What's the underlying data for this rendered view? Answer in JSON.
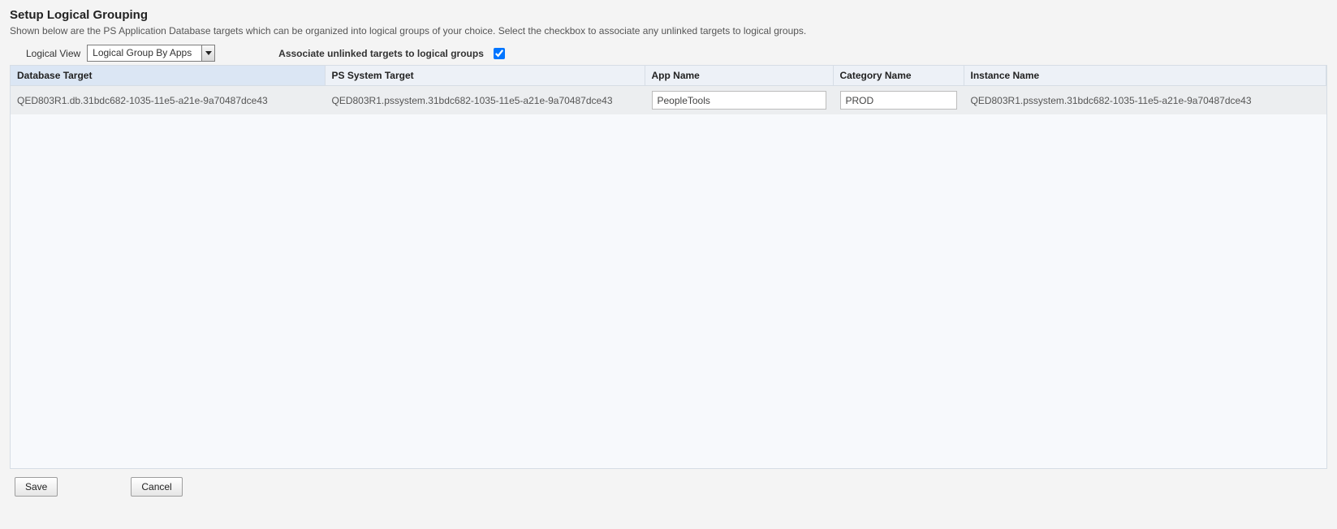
{
  "header": {
    "title": "Setup Logical Grouping",
    "description": "Shown below are the PS Application Database targets which can be organized into logical groups of your choice. Select the checkbox to associate any unlinked targets to logical groups."
  },
  "controls": {
    "logical_view_label": "Logical View",
    "logical_view_value": "Logical Group By Apps",
    "associate_label": "Associate unlinked targets to logical groups",
    "associate_checked": true
  },
  "table": {
    "columns": {
      "database_target": "Database Target",
      "ps_system_target": "PS System Target",
      "app_name": "App Name",
      "category_name": "Category Name",
      "instance_name": "Instance Name"
    },
    "rows": [
      {
        "database_target": "QED803R1.db.31bdc682-1035-11e5-a21e-9a70487dce43",
        "ps_system_target": "QED803R1.pssystem.31bdc682-1035-11e5-a21e-9a70487dce43",
        "app_name": "PeopleTools",
        "category_name": "PROD",
        "instance_name": "QED803R1.pssystem.31bdc682-1035-11e5-a21e-9a70487dce43"
      }
    ]
  },
  "actions": {
    "save": "Save",
    "cancel": "Cancel"
  }
}
